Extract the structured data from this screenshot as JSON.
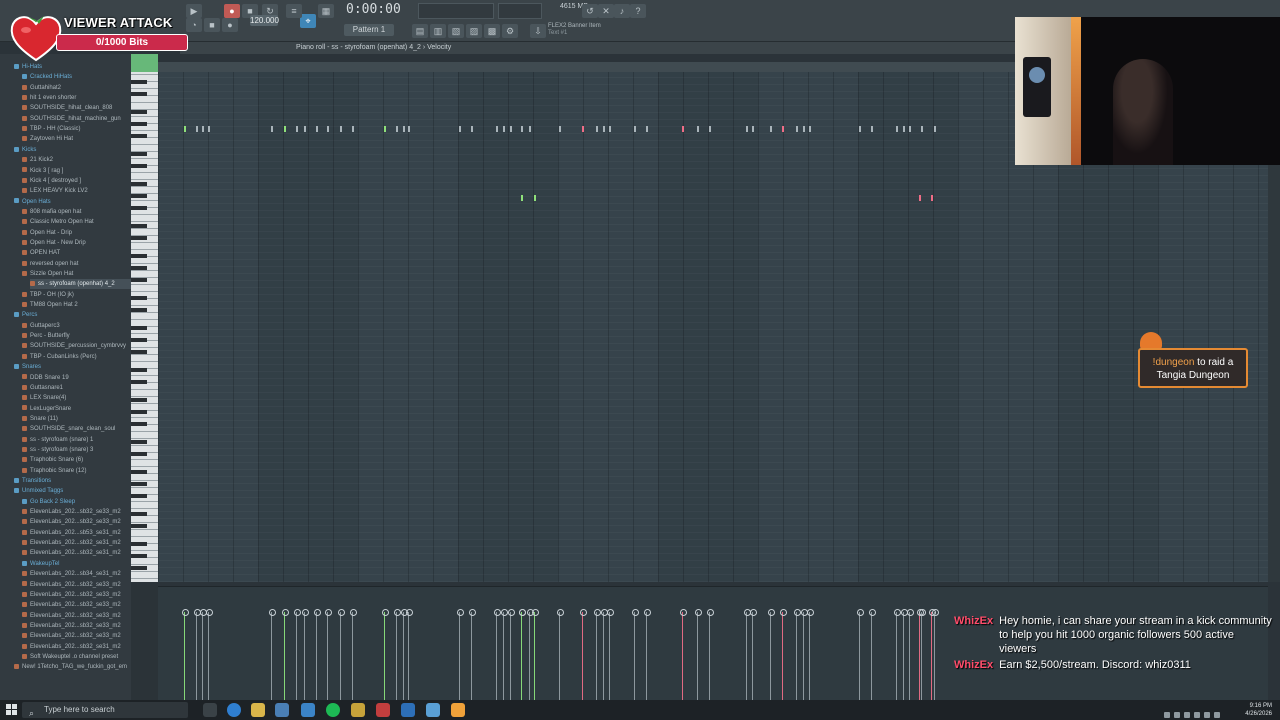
{
  "overlay": {
    "title": "VIEWER ATTACK",
    "progress_label": "0/1000 Bits",
    "progress_value": 0,
    "progress_max": 1000
  },
  "toolbar": {
    "time": "0:00:00",
    "pattern": "Pattern 1",
    "tempo": "120.000",
    "memory": "4615 MB",
    "hint_line1": "FLEX2 Banner Item",
    "hint_line2": "Text #1"
  },
  "piano_roll": {
    "title": "Piano roll - ss - styrofoam (openhat) 4_2 › Velocity",
    "notes_row1": [
      184,
      196,
      202,
      208,
      271,
      284,
      296,
      304,
      316,
      327,
      340,
      352,
      384,
      396,
      403,
      408,
      459,
      471,
      496,
      503,
      510,
      521,
      529,
      559,
      582,
      596,
      603,
      609,
      634,
      646,
      682,
      697,
      709,
      746,
      752,
      770,
      782,
      796,
      803,
      809,
      859,
      871,
      896,
      903,
      909,
      921,
      934
    ],
    "green_notes": [
      184,
      284,
      384
    ],
    "red_notes": [
      582,
      682,
      782
    ],
    "notes_row2": [
      521,
      534,
      919,
      931
    ]
  },
  "browser": {
    "items": [
      {
        "label": "Hi-Hats",
        "type": "folder",
        "indent": 1
      },
      {
        "label": "Cracked HiHats",
        "type": "folder",
        "indent": 2
      },
      {
        "label": "Guttahihat2",
        "type": "file",
        "indent": 2
      },
      {
        "label": "hit 1 even shorter",
        "type": "file",
        "indent": 2
      },
      {
        "label": "SOUTHSIDE_hihat_clean_808",
        "type": "file",
        "indent": 2
      },
      {
        "label": "SOUTHSIDE_hihat_machine_gun",
        "type": "file",
        "indent": 2
      },
      {
        "label": "TBP - HH (Classic)",
        "type": "file",
        "indent": 2
      },
      {
        "label": "Zaytoven Hi Hat",
        "type": "file",
        "indent": 2
      },
      {
        "label": "Kicks",
        "type": "folder",
        "indent": 1
      },
      {
        "label": "21 Kick2",
        "type": "file",
        "indent": 2
      },
      {
        "label": "Kick 3 [ rag ]",
        "type": "file",
        "indent": 2
      },
      {
        "label": "Kick 4 [ destroyed ]",
        "type": "file",
        "indent": 2
      },
      {
        "label": "LEX HEAVY Kick LV2",
        "type": "file",
        "indent": 2
      },
      {
        "label": "Open Hats",
        "type": "folder",
        "indent": 1
      },
      {
        "label": "808 mafia open hat",
        "type": "file",
        "indent": 2
      },
      {
        "label": "Classic Metro Open Hat",
        "type": "file",
        "indent": 2
      },
      {
        "label": "Open Hat - Drip",
        "type": "file",
        "indent": 2
      },
      {
        "label": "Open Hat - New Drip",
        "type": "file",
        "indent": 2
      },
      {
        "label": "OPEN HAT",
        "type": "file",
        "indent": 2
      },
      {
        "label": "reversed open hat",
        "type": "file",
        "indent": 2
      },
      {
        "label": "Sizzle Open Hat",
        "type": "file",
        "indent": 2
      },
      {
        "label": "ss - styrofoam (openhat) 4_2",
        "type": "file",
        "indent": 3,
        "selected": true
      },
      {
        "label": "TBP - OH (IO jk)",
        "type": "file",
        "indent": 2
      },
      {
        "label": "TM88 Open Hat 2",
        "type": "file",
        "indent": 2
      },
      {
        "label": "Percs",
        "type": "folder",
        "indent": 1
      },
      {
        "label": "Guttaperc3",
        "type": "file",
        "indent": 2
      },
      {
        "label": "Perc - Butterfly",
        "type": "file",
        "indent": 2
      },
      {
        "label": "SOUTHSIDE_percussion_cymbrvvy",
        "type": "file",
        "indent": 2
      },
      {
        "label": "TBP - CubanLinks (Perc)",
        "type": "file",
        "indent": 2
      },
      {
        "label": "Snares",
        "type": "folder",
        "indent": 1
      },
      {
        "label": "DDB Snare 19",
        "type": "file",
        "indent": 2
      },
      {
        "label": "Guttasnare1",
        "type": "file",
        "indent": 2
      },
      {
        "label": "LEX Snare(4)",
        "type": "file",
        "indent": 2
      },
      {
        "label": "LexLugerSnare",
        "type": "file",
        "indent": 2
      },
      {
        "label": "Snare (11)",
        "type": "file",
        "indent": 2
      },
      {
        "label": "SOUTHSIDE_snare_clean_soul",
        "type": "file",
        "indent": 2
      },
      {
        "label": "ss - styrofoam (snare) 1",
        "type": "file",
        "indent": 2
      },
      {
        "label": "ss - styrofoam (snare) 3",
        "type": "file",
        "indent": 2
      },
      {
        "label": "Traphobic Snare (6)",
        "type": "file",
        "indent": 2
      },
      {
        "label": "Traphobic Snare (12)",
        "type": "file",
        "indent": 2
      },
      {
        "label": "Transitions",
        "type": "folder",
        "indent": 1
      },
      {
        "label": "Unmixed Taggs",
        "type": "folder",
        "indent": 1
      },
      {
        "label": "Go Back 2 Sleep",
        "type": "folder",
        "indent": 2
      },
      {
        "label": "ElevenLabs_202...sb32_se33_m2",
        "type": "file",
        "indent": 2
      },
      {
        "label": "ElevenLabs_202...sb32_se33_m2",
        "type": "file",
        "indent": 2
      },
      {
        "label": "ElevenLabs_202...sb53_se31_m2",
        "type": "file",
        "indent": 2
      },
      {
        "label": "ElevenLabs_202...sb32_se31_m2",
        "type": "file",
        "indent": 2
      },
      {
        "label": "ElevenLabs_202...sb32_se31_m2",
        "type": "file",
        "indent": 2
      },
      {
        "label": "WakeupTel",
        "type": "folder",
        "indent": 2
      },
      {
        "label": "ElevenLabs_202...sb34_se31_m2",
        "type": "file",
        "indent": 2
      },
      {
        "label": "ElevenLabs_202...sb32_se33_m2",
        "type": "file",
        "indent": 2
      },
      {
        "label": "ElevenLabs_202...sb32_se33_m2",
        "type": "file",
        "indent": 2
      },
      {
        "label": "ElevenLabs_202...sb32_se33_m2",
        "type": "file",
        "indent": 2
      },
      {
        "label": "ElevenLabs_202...sb32_se33_m2",
        "type": "file",
        "indent": 2
      },
      {
        "label": "ElevenLabs_202...sb32_se33_m2",
        "type": "file",
        "indent": 2
      },
      {
        "label": "ElevenLabs_202...sb32_se33_m2",
        "type": "file",
        "indent": 2
      },
      {
        "label": "ElevenLabs_202...sb32_se31_m2",
        "type": "file",
        "indent": 2
      },
      {
        "label": "Soft Wakeuptel .o channel preset",
        "type": "file",
        "indent": 2
      },
      {
        "label": "New! 1Tetcho_TAG_we_fuckin_got_em",
        "type": "file",
        "indent": 1
      }
    ]
  },
  "raid": {
    "command": "!dungeon",
    "text": "to raid a Tangia Dungeon"
  },
  "chat": [
    {
      "user": "WhizEx",
      "text": "Hey homie, i can share your stream in a kick community to help you hit 1000 organic followers 500 active viewers"
    },
    {
      "user": "WhizEx",
      "text": "Earn $2,500/stream. Discord: whiz0311"
    }
  ],
  "taskbar": {
    "search_placeholder": "Type here to search",
    "time": "9:16 PM",
    "date": "4/26/2026"
  },
  "colors": {
    "note_green": "#8fe07a",
    "note_red": "#ef6d86",
    "overlay_bar": "#cb2a4b",
    "raid_border": "#e58a33",
    "chat_user": "#ff4c6a"
  }
}
